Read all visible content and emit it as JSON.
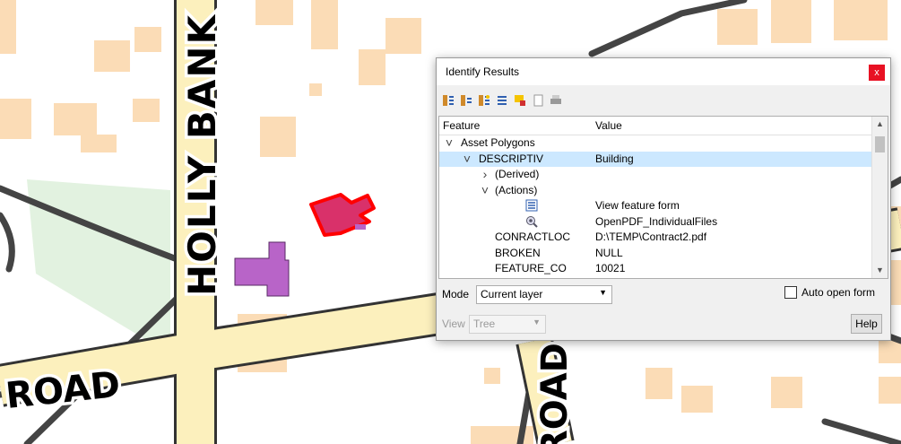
{
  "map": {
    "labels": {
      "road_vertical": "HOLLY BANK",
      "road_bottom_left": "ROAD",
      "road_bottom_center": "ROAD"
    }
  },
  "dialog": {
    "title": "Identify Results",
    "close_glyph": "x",
    "toolbar_icons": [
      "expand-tree-icon",
      "collapse-tree-icon",
      "expand-new-icon",
      "form-icon",
      "highlight-icon",
      "copy-icon",
      "print-icon"
    ],
    "tree": {
      "col_feature": "Feature",
      "col_value": "Value",
      "rows": [
        {
          "feature": "Asset Polygons",
          "value": "",
          "level": 0,
          "chevron": "down"
        },
        {
          "feature": "DESCRIPTIV",
          "value": "Building",
          "level": 1,
          "chevron": "down",
          "selected": true
        },
        {
          "feature": "(Derived)",
          "value": "",
          "level": 2,
          "chevron": "right"
        },
        {
          "feature": "(Actions)",
          "value": "",
          "level": 2,
          "chevron": "down"
        },
        {
          "feature": "",
          "value": "View feature form",
          "level": 3,
          "icon": "form-icon"
        },
        {
          "feature": "",
          "value": "OpenPDF_IndividualFiles",
          "level": 3,
          "icon": "action-gear-icon"
        },
        {
          "feature": "CONRACTLOC",
          "value": "D:\\TEMP\\Contract2.pdf",
          "level": 2
        },
        {
          "feature": "BROKEN",
          "value": "NULL",
          "level": 2
        },
        {
          "feature": "FEATURE_CO",
          "value": "10021",
          "level": 2
        }
      ]
    },
    "mode": {
      "label": "Mode",
      "value": "Current layer"
    },
    "auto_open": {
      "label": "Auto open form",
      "checked": false
    },
    "view": {
      "label": "View",
      "value": "Tree"
    },
    "help_label": "Help"
  }
}
